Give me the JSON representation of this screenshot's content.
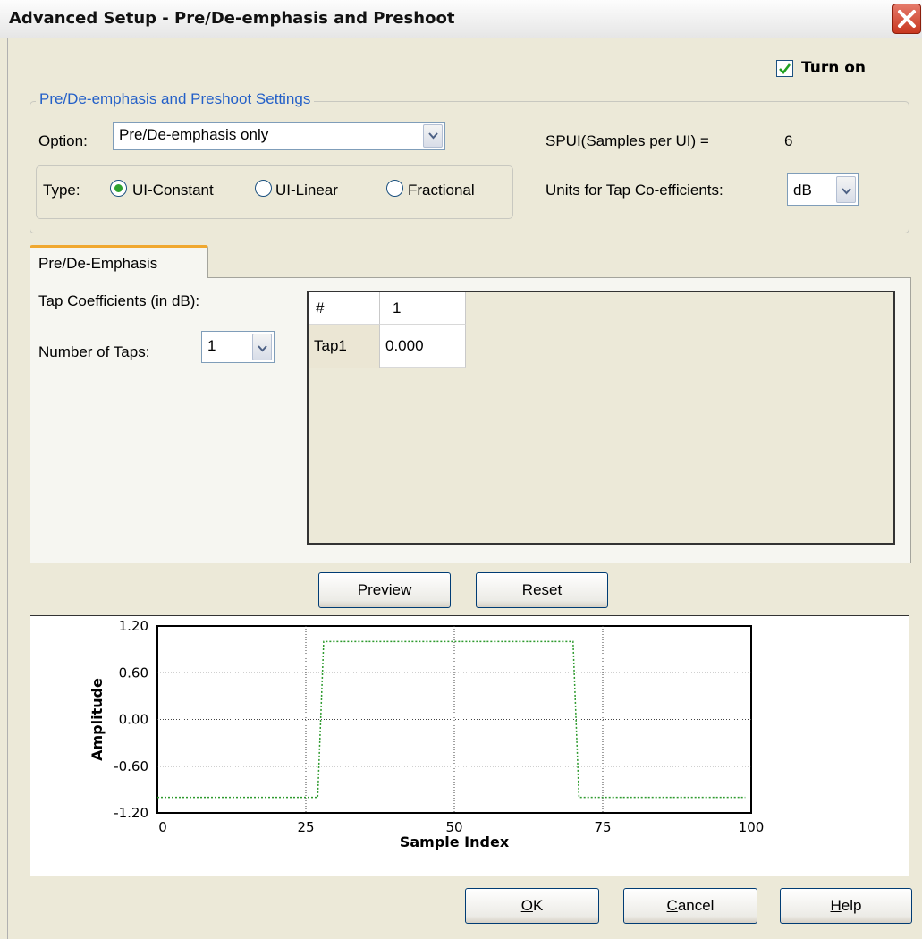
{
  "window": {
    "title": "Advanced Setup - Pre/De-emphasis and Preshoot"
  },
  "turn_on": {
    "label": "Turn on",
    "checked": true
  },
  "settings": {
    "legend": "Pre/De-emphasis and  Preshoot Settings",
    "option_label": "Option:",
    "option_value": "Pre/De-emphasis only",
    "spui_label": "SPUI(Samples per UI) =",
    "spui_value": "6",
    "type_label": "Type:",
    "types": [
      "UI-Constant",
      "UI-Linear",
      "Fractional"
    ],
    "type_selected": "UI-Constant",
    "units_label": "Units for Tap Co-efficients:",
    "units_value": "dB"
  },
  "tab": {
    "label": "Pre/De-Emphasis",
    "coeff_label": "Tap Coefficients (in dB):",
    "num_taps_label": "Number of Taps:",
    "num_taps_value": "1",
    "grid": {
      "headers": [
        "#",
        "1"
      ],
      "rows": [
        {
          "name": "Tap1",
          "value": "0.000"
        }
      ]
    }
  },
  "buttons": {
    "preview": {
      "mnemonic": "P",
      "rest": "review"
    },
    "reset": {
      "mnemonic": "R",
      "rest": "eset"
    },
    "ok": {
      "mnemonic": "O",
      "rest": "K"
    },
    "cancel": {
      "mnemonic": "C",
      "rest": "ancel"
    },
    "help": {
      "mnemonic": "H",
      "rest": "elp"
    }
  },
  "chart_data": {
    "type": "line",
    "xlabel": "Sample Index",
    "ylabel": "Amplitude",
    "xlim": [
      0,
      100
    ],
    "ylim": [
      -1.2,
      1.2
    ],
    "x_ticks": [
      "0",
      "25",
      "50",
      "75",
      "100"
    ],
    "y_ticks": [
      "1.20",
      "0.60",
      "0.00",
      "-0.60",
      "-1.20"
    ],
    "grid": true,
    "series": [
      {
        "color": "#2e9a2e",
        "style": "dotted",
        "x": [
          0,
          27,
          28,
          70,
          71,
          99
        ],
        "y": [
          -1.0,
          -1.0,
          1.0,
          1.0,
          -1.0,
          -1.0
        ]
      }
    ]
  }
}
